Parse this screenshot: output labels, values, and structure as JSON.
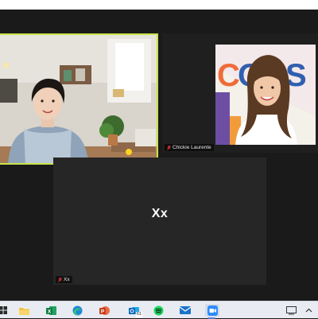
{
  "participants": [
    {
      "id": "speaker",
      "name": "",
      "active_speaker": true,
      "video_on": true
    },
    {
      "id": "chickie",
      "name": "Chickie Laurente",
      "muted": true,
      "video_on": true
    },
    {
      "id": "xx",
      "name": "Xx",
      "display_text": "Xx",
      "muted": true,
      "video_on": false
    }
  ],
  "taskbar": {
    "apps": [
      {
        "name": "start",
        "icon": "start-icon"
      },
      {
        "name": "file-explorer",
        "icon": "folder-icon"
      },
      {
        "name": "excel",
        "icon": "excel-icon"
      },
      {
        "name": "edge",
        "icon": "edge-icon"
      },
      {
        "name": "powerpoint",
        "icon": "powerpoint-icon"
      },
      {
        "name": "outlook",
        "icon": "outlook-icon",
        "badge": "61"
      },
      {
        "name": "spotify",
        "icon": "spotify-icon"
      },
      {
        "name": "mail",
        "icon": "mail-icon"
      },
      {
        "name": "zoom",
        "icon": "zoom-icon"
      }
    ]
  },
  "colors": {
    "active_speaker_border": "#c8e44b",
    "meeting_bg": "#1a1a1a",
    "taskbar_bg": "#e8ecf2",
    "muted_red": "#e53935"
  }
}
